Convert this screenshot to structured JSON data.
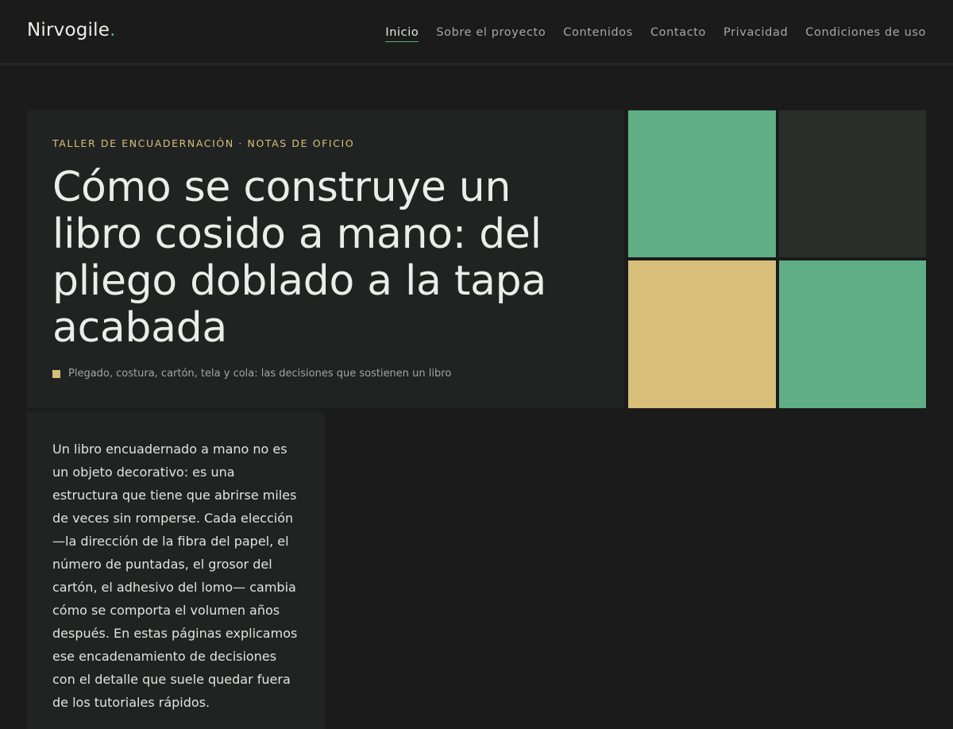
{
  "brand": {
    "name": "Nirvogile",
    "dot": "."
  },
  "nav": {
    "items": [
      {
        "label": "Inicio",
        "active": true
      },
      {
        "label": "Sobre el proyecto",
        "active": false
      },
      {
        "label": "Contenidos",
        "active": false
      },
      {
        "label": "Contacto",
        "active": false
      },
      {
        "label": "Privacidad",
        "active": false
      },
      {
        "label": "Condiciones de uso",
        "active": false
      }
    ]
  },
  "hero": {
    "eyebrow": "TALLER DE ENCUADERNACIÓN · NOTAS DE OFICIO",
    "title": "Cómo se construye un libro cosido a mano: del pliego doblado a la tapa acabada",
    "caption": "Plegado, costura, cartón, tela y cola: las decisiones que sostienen un libro"
  },
  "intro": {
    "text": "Un libro encuadernado a mano no es un objeto decorativo: es una estructura que tiene que abrirse miles de veces sin romperse. Cada elección —la dirección de la fibra del papel, el número de puntadas, el grosor del cartón, el adhesivo del lomo— cambia cómo se comporta el volumen años después. En estas páginas explicamos ese encadenamiento de decisiones con el detalle que suele quedar fuera de los tutoriales rápidos."
  },
  "colors": {
    "background": "#1a1b1a",
    "panel": "#202322",
    "accent_green": "#5fae86",
    "accent_yellow": "#d8c07a",
    "tile_dark": "#2a2e2b"
  }
}
